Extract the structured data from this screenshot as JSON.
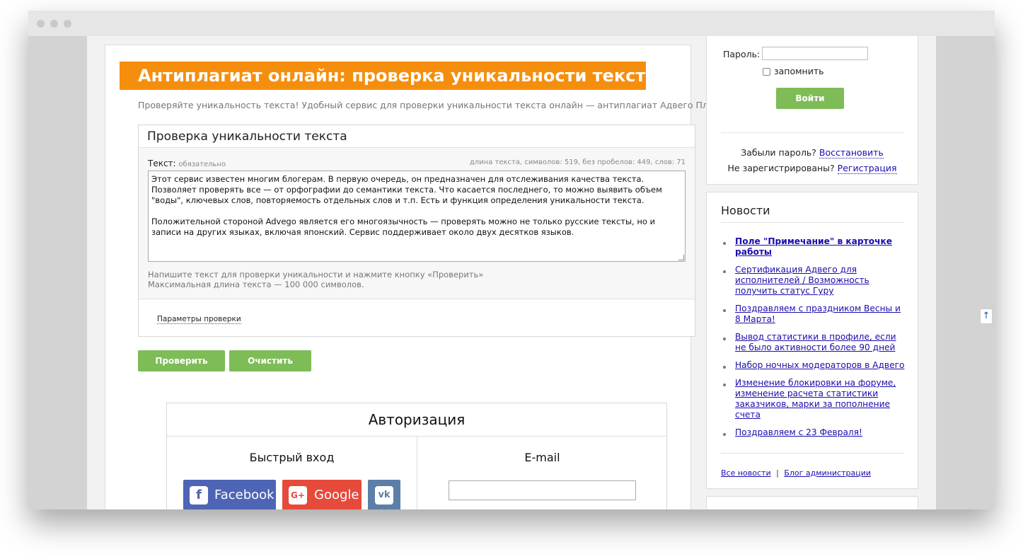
{
  "header": {
    "title": "Антиплагиат онлайн: проверка уникальности текста",
    "subtitle": "Проверяйте уникальность текста! Удобный сервис для проверки уникальности текста онлайн — антиплагиат Адвего Плагиатус"
  },
  "checker": {
    "panel_title": "Проверка уникальности текста",
    "text_label": "Текст:",
    "required_label": "обязательно",
    "stats": "длина текста, символов: 519, без пробелов: 449, слов: 71",
    "text_value_p1": "Этот сервис известен многим блогерам. В первую очередь, он предназначен для отслеживания качества текста. Позволяет проверять все — от орфографии до семантики текста. Что касается последнего, то можно выявить объем \"воды\", ключевых слов, повторяемость отдельных слов и т.п. Есть и функция определения уникальности текста.",
    "text_value_p2": "Положительной стороной Advego является его многоязычность — проверять можно не только русские тексты, но и записи на других языках, включая японский. Сервис поддерживает около двух десятков языков.",
    "hint_line1": "Напишите текст для проверки уникальности и нажмите кнопку «Проверить»",
    "hint_line2": "Максимальная длина текста — 100 000 символов.",
    "params_link": "Параметры проверки",
    "check_button": "Проверить",
    "clear_button": "Очистить"
  },
  "auth": {
    "title": "Авторизация",
    "quick_login": "Быстрый вход",
    "email_title": "E-mail",
    "facebook": "Facebook",
    "google": "Google",
    "facebook_icon_glyph": "f",
    "google_icon_glyph": "G+",
    "vk_icon_glyph": "vk"
  },
  "login": {
    "password_label": "Пароль:",
    "remember_label": "запомнить",
    "login_button": "Войти",
    "forgot_text": "Забыли пароль?",
    "restore_link": "Восстановить",
    "not_registered_text": "Не зарегистрированы?",
    "register_link": "Регистрация"
  },
  "news": {
    "title": "Новости",
    "items": [
      "Поле \"Примечание\" в карточке работы",
      "Сертификация Адвего для исполнителей / Возможность получить статус Гуру",
      "Поздравляем с праздником Весны и 8 Марта!",
      "Вывод статистики в профиле, если не было активности более 90 дней",
      "Набор ночных модераторов в Адвего",
      "Изменение блокировки на форуме, изменение расчета статистики заказчиков, марки за пополнение счета",
      "Поздравляем с 23 Февраля!"
    ],
    "all_news_link": "Все новости",
    "separator": "|",
    "blog_link": "Блог администрации"
  },
  "scroll_top_glyph": "↑",
  "colors": {
    "banner": "#f68e0d",
    "button_green": "#7ebc57",
    "facebook": "#4e64b5",
    "google": "#e64a3b",
    "vk": "#5b7fa6",
    "link": "#1a0dab"
  }
}
